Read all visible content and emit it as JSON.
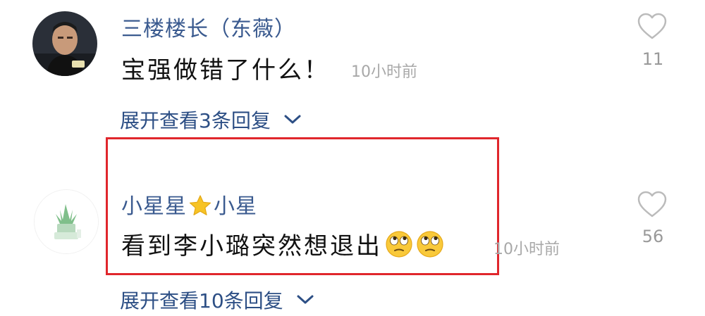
{
  "comments": [
    {
      "username": "三楼楼长（东薇）",
      "text": "宝强做错了什么！",
      "time": "10小时前",
      "likes": "11",
      "expand_label": "展开查看3条回复"
    },
    {
      "username_part1": "小星星",
      "username_star_icon": "star-emoji",
      "username_part2": "小星",
      "text": "看到李小璐突然想退出",
      "text_emojis": [
        "face-with-rolling-eyes",
        "face-with-rolling-eyes"
      ],
      "time": "10小时前",
      "likes": "56",
      "expand_label": "展开查看10条回复"
    }
  ],
  "colors": {
    "username": "#3a5a8f",
    "expand_link": "#2d4f85",
    "highlight_border": "#e0262c",
    "timestamp": "#a8a8a8",
    "like_icon": "#bbbbbb"
  }
}
